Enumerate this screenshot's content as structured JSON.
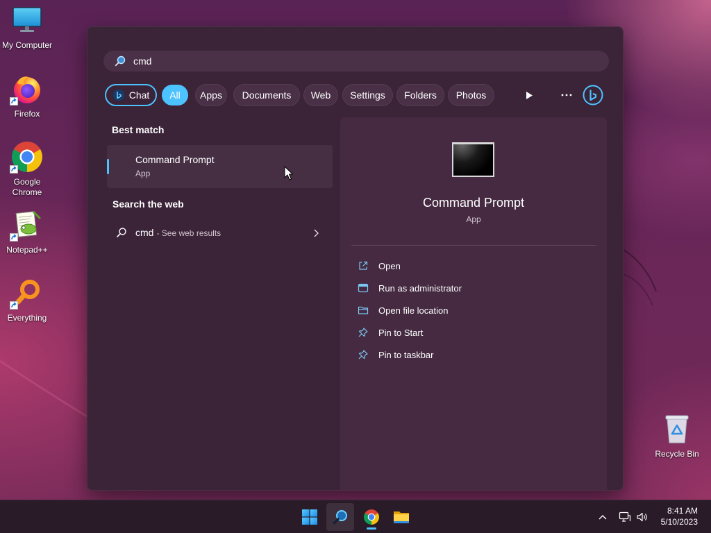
{
  "desktop": {
    "icons": [
      {
        "label": "My Computer",
        "icon": "monitor-icon"
      },
      {
        "label": "Firefox",
        "icon": "firefox-icon"
      },
      {
        "label": "Google Chrome",
        "icon": "chrome-icon"
      },
      {
        "label": "Notepad++",
        "icon": "notepad-plus-plus-icon"
      },
      {
        "label": "Everything",
        "icon": "everything-icon"
      }
    ],
    "recycle_bin": {
      "label": "Recycle Bin",
      "icon": "recycle-bin-icon"
    }
  },
  "search_panel": {
    "search_box": {
      "value": "cmd",
      "icon": "search-icon"
    },
    "filters": {
      "chat_label": "Chat",
      "chat_icon": "bing-chat-icon",
      "items": [
        {
          "label": "All",
          "selected": true
        },
        {
          "label": "Apps"
        },
        {
          "label": "Documents"
        },
        {
          "label": "Web"
        },
        {
          "label": "Settings"
        },
        {
          "label": "Folders"
        },
        {
          "label": "Photos"
        }
      ],
      "extra_icons": [
        "play-icon",
        "more-icon",
        "bing-icon"
      ]
    },
    "best_match": {
      "heading": "Best match",
      "title": "Command Prompt",
      "subtitle": "App"
    },
    "search_web": {
      "heading": "Search the web",
      "query": "cmd",
      "suffix": "- See web results"
    },
    "preview": {
      "title": "Command Prompt",
      "subtitle": "App",
      "actions": [
        {
          "label": "Open",
          "icon": "open-icon"
        },
        {
          "label": "Run as administrator",
          "icon": "admin-icon"
        },
        {
          "label": "Open file location",
          "icon": "folder-icon"
        },
        {
          "label": "Pin to Start",
          "icon": "pin-icon"
        },
        {
          "label": "Pin to taskbar",
          "icon": "pin-icon"
        }
      ]
    }
  },
  "taskbar": {
    "apps": [
      {
        "icon": "windows-start-icon"
      },
      {
        "icon": "search-icon",
        "active": true
      },
      {
        "icon": "chrome-icon",
        "running": true
      },
      {
        "icon": "file-explorer-icon"
      }
    ],
    "tray_icons": [
      "chevron-up-icon",
      "network-icon",
      "volume-icon"
    ],
    "clock": {
      "time": "8:41 AM",
      "date": "5/10/2023"
    }
  },
  "colors": {
    "accent": "#4cc2ff",
    "panel": "#3b2338",
    "pane": "#452a41",
    "taskbar": "#2a1b29"
  }
}
